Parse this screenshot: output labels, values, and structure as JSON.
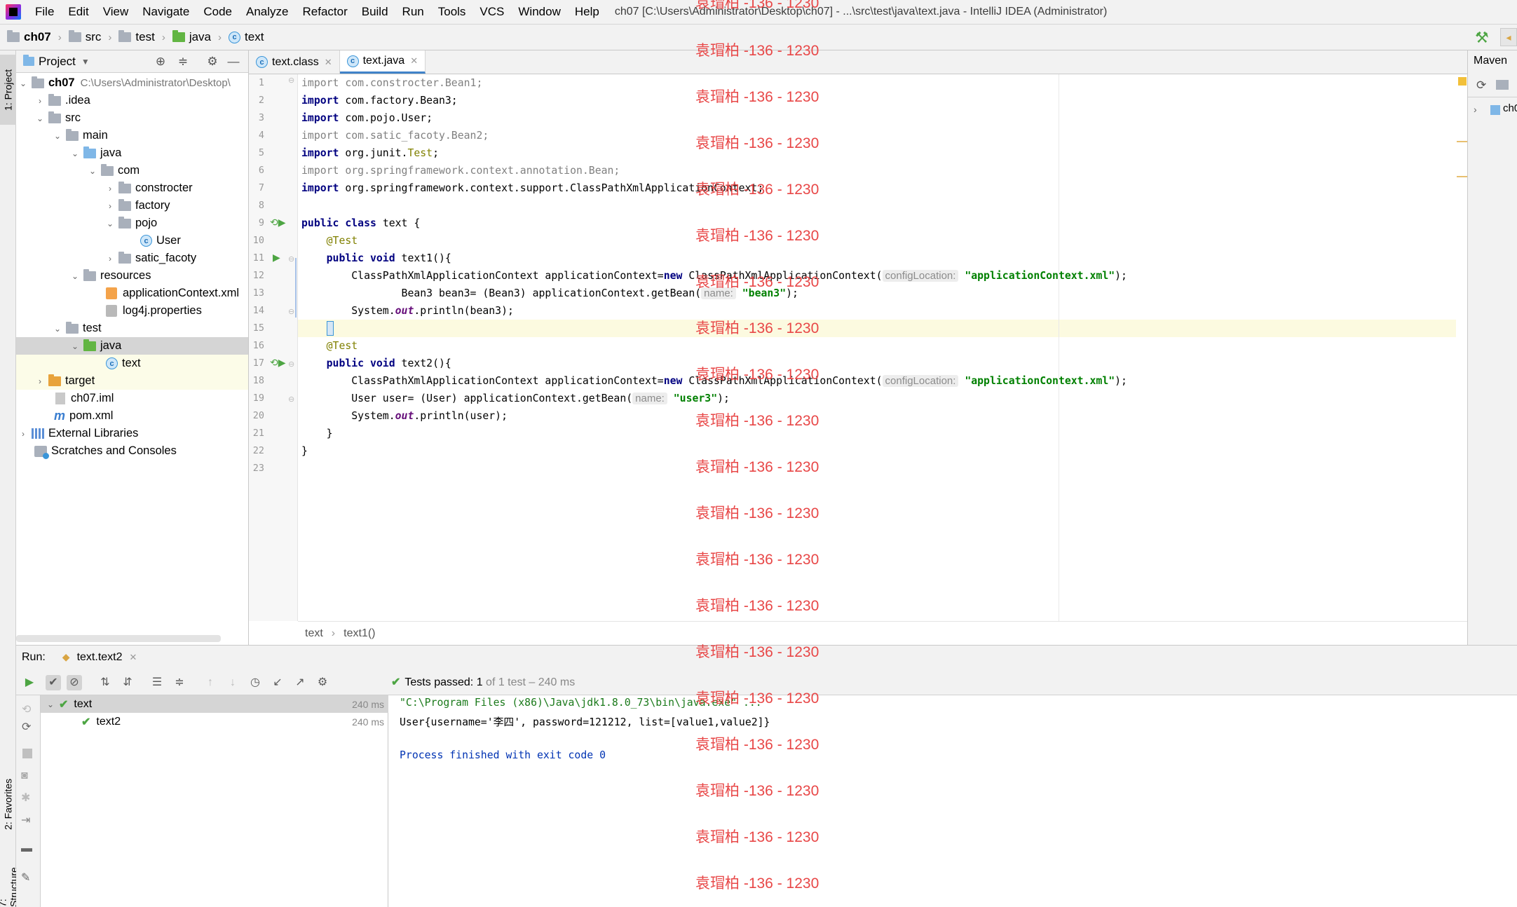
{
  "menubar": {
    "items": [
      "File",
      "Edit",
      "View",
      "Navigate",
      "Code",
      "Analyze",
      "Refactor",
      "Build",
      "Run",
      "Tools",
      "VCS",
      "Window",
      "Help"
    ],
    "title": "ch07 [C:\\Users\\Administrator\\Desktop\\ch07] - ...\\src\\test\\java\\text.java - IntelliJ IDEA (Administrator)"
  },
  "navbar": {
    "crumbs": [
      "ch07",
      "src",
      "test",
      "java",
      "text"
    ]
  },
  "left_strip": {
    "project_tab": "1: Project",
    "favorites_tab": "2: Favorites",
    "structure_tab": "7: Structure"
  },
  "project": {
    "header": "Project",
    "tree": [
      {
        "label": "ch07",
        "extra": "C:\\Users\\Administrator\\Desktop\\"
      },
      {
        "label": ".idea"
      },
      {
        "label": "src"
      },
      {
        "label": "main"
      },
      {
        "label": "java"
      },
      {
        "label": "com"
      },
      {
        "label": "constrocter"
      },
      {
        "label": "factory"
      },
      {
        "label": "pojo"
      },
      {
        "label": "User"
      },
      {
        "label": "satic_facoty"
      },
      {
        "label": "resources"
      },
      {
        "label": "applicationContext.xml"
      },
      {
        "label": "log4j.properties"
      },
      {
        "label": "test"
      },
      {
        "label": "java"
      },
      {
        "label": "text"
      },
      {
        "label": "target"
      },
      {
        "label": "ch07.iml"
      },
      {
        "label": "pom.xml"
      },
      {
        "label": "External Libraries"
      },
      {
        "label": "Scratches and Consoles"
      }
    ]
  },
  "editor": {
    "tabs": [
      "text.class",
      "text.java"
    ],
    "line_numbers": [
      "1",
      "2",
      "3",
      "4",
      "5",
      "6",
      "7",
      "8",
      "9",
      "10",
      "11",
      "12",
      "13",
      "14",
      "15",
      "16",
      "17",
      "18",
      "19",
      "20",
      "21",
      "22",
      "23"
    ],
    "code": {
      "l1a": "import",
      "l1b": " com.constrocter.Bean1;",
      "l2a": "import",
      "l2b": " com.factory.Bean3;",
      "l3a": "import",
      "l3b": " com.pojo.User;",
      "l4a": "import",
      "l4b": " com.satic_facoty.Bean2;",
      "l5a": "import",
      "l5b": " org.junit.",
      "l5c": "Test",
      "l5d": ";",
      "l6a": "import",
      "l6b": " org.springframework.context.annotation.Bean;",
      "l7a": "import",
      "l7b": " org.springframework.context.support.ClassPathXmlApplicationContext;",
      "l9a": "public class",
      "l9b": " text {",
      "l10": "    @Test",
      "l11a": "    public void",
      "l11b": " text1(){",
      "l12a": "        ClassPathXmlApplicationContext applicationContext=",
      "l12b": "new",
      "l12c": " ClassPathXmlApplicationContext(",
      "l12hint": "configLocation:",
      "l12d": " \"applicationContext.xml\"",
      "l12e": ");",
      "l13a": "                Bean3 bean3= (Bean3) applicationContext.getBean(",
      "l13hint": "name:",
      "l13b": " \"bean3\"",
      "l13c": ");",
      "l14a": "        System.",
      "l14b": "out",
      "l14c": ".println(bean3);",
      "l15": "    }",
      "l16": "    @Test",
      "l17a": "    public void",
      "l17b": " text2(){",
      "l18a": "        ClassPathXmlApplicationContext applicationContext=",
      "l18b": "new",
      "l18c": " ClassPathXmlApplicationContext(",
      "l18hint": "configLocation:",
      "l18d": " \"applicationContext.xml\"",
      "l18e": ");",
      "l19a": "        User user= (User) applicationContext.getBean(",
      "l19hint": "name:",
      "l19b": " \"user3\"",
      "l19c": ");",
      "l20a": "        System.",
      "l20b": "out",
      "l20c": ".println(user);",
      "l21": "    }",
      "l22": "}"
    },
    "breadcrumb": [
      "text",
      "text1()"
    ]
  },
  "maven": {
    "title": "Maven",
    "item": "ch0"
  },
  "run": {
    "label": "Run:",
    "tab": "text.text2",
    "status_prefix": "Tests passed:",
    "status_count": "1",
    "status_rest": "of 1 test – 240 ms",
    "tree": [
      {
        "label": "text",
        "time": "240 ms"
      },
      {
        "label": "text2",
        "time": "240 ms"
      }
    ],
    "console": [
      "\"C:\\Program Files (x86)\\Java\\jdk1.8.0_73\\bin\\java.exe\" ...",
      "User{username='李四', password=121212, list=[value1,value2]}",
      "Process finished with exit code 0"
    ]
  },
  "watermark": "袁瑁柏 -136 - 1230",
  "colors": {
    "accent": "#4083c9",
    "keyword": "#000080",
    "string": "#008000",
    "annotation": "#808000",
    "watermark": "#e84747"
  }
}
